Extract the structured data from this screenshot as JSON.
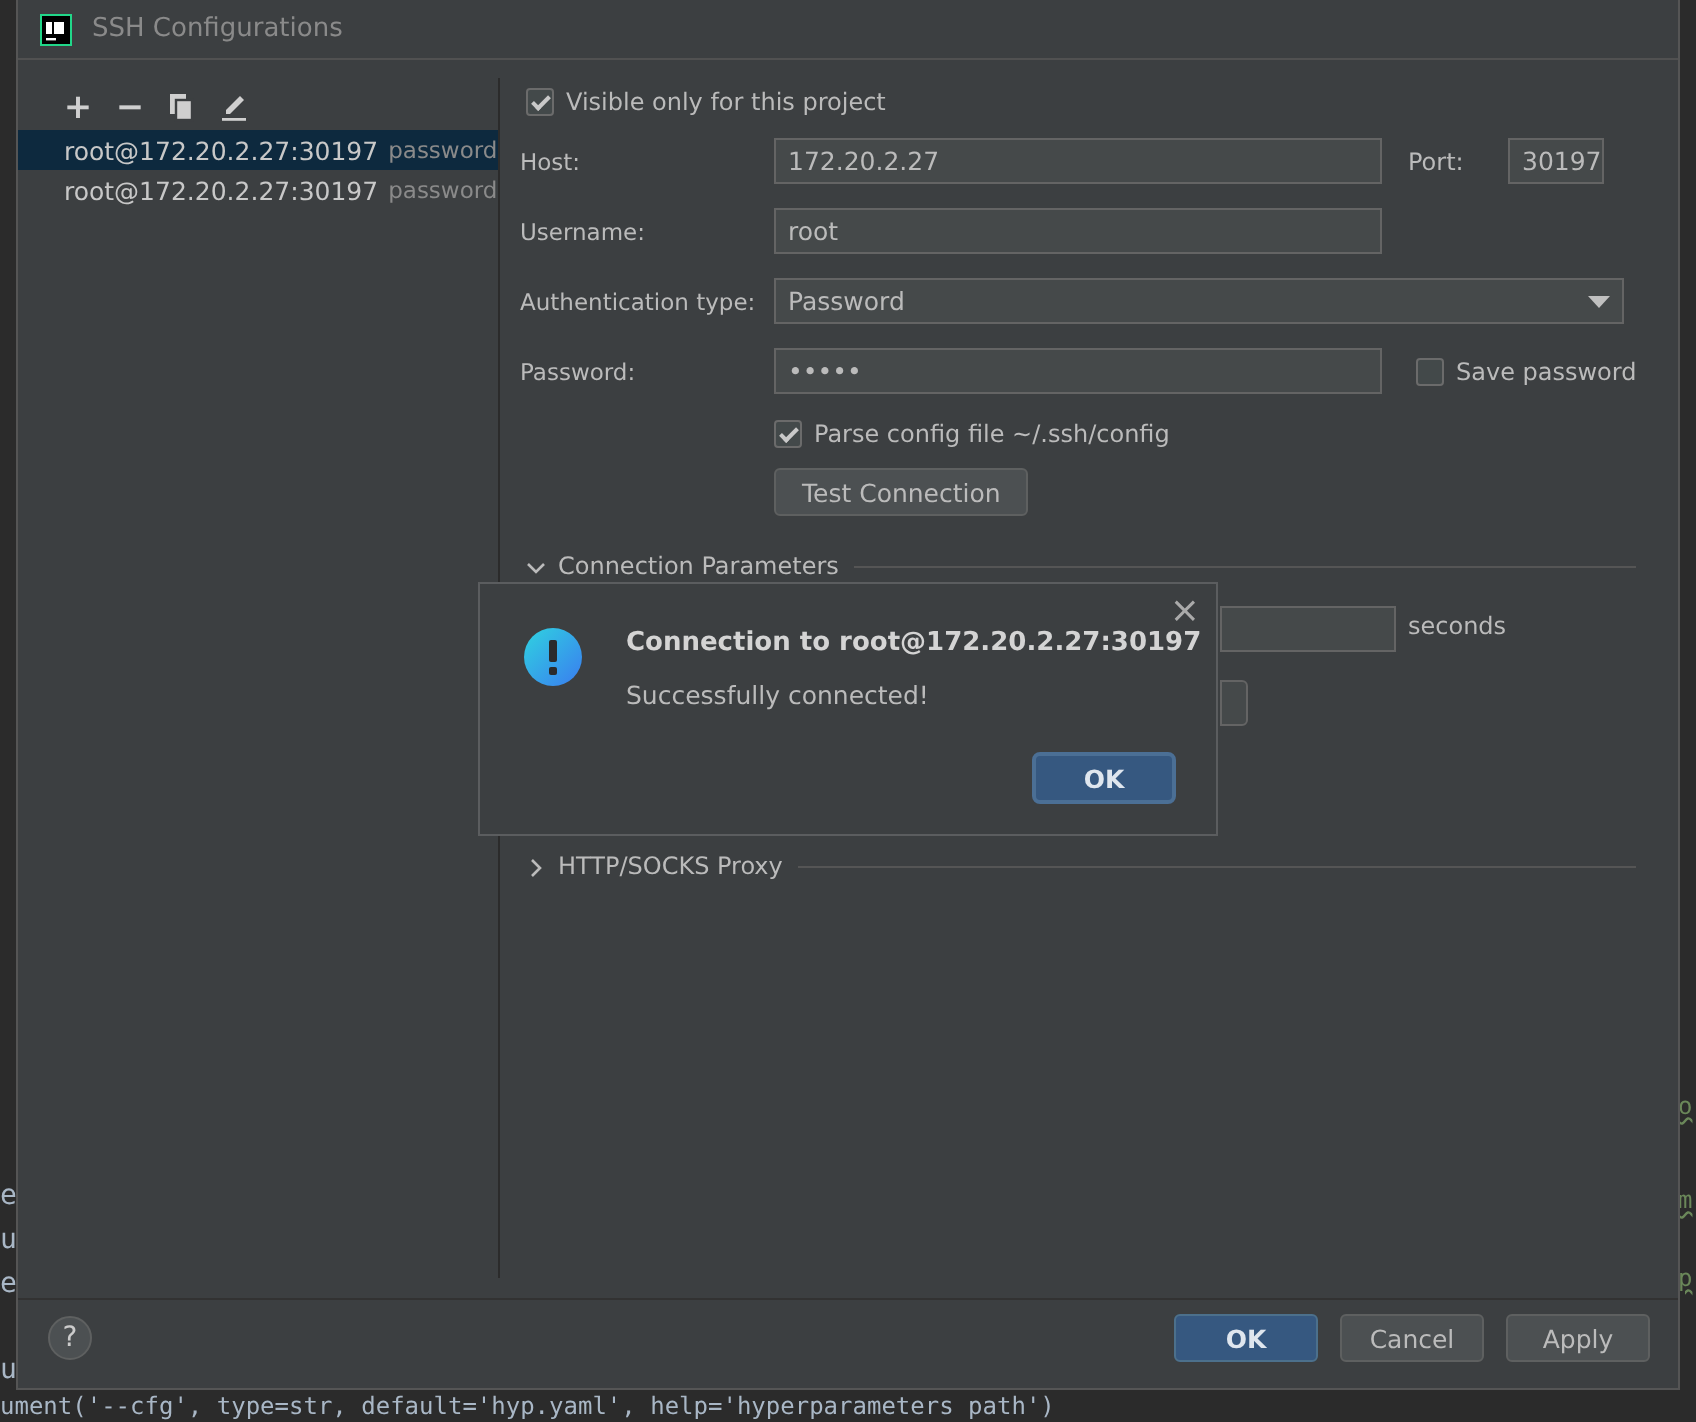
{
  "editor": {
    "left_fragments": [
      "e",
      "u",
      "e",
      "u"
    ],
    "right_fragments": [
      "o",
      "m",
      "p"
    ],
    "bottom_line": "ument('--cfg', type=str, default='hyp.yaml', help='hyperparameters path')"
  },
  "window": {
    "title": "SSH Configurations"
  },
  "toolbar": [
    "+",
    "−"
  ],
  "connections": [
    {
      "name": "root@172.20.2.27:30197",
      "auth": "password",
      "selected": true
    },
    {
      "name": "root@172.20.2.27:30197",
      "auth": "password",
      "selected": false
    }
  ],
  "form": {
    "visible_only_label": "Visible only for this project",
    "visible_only": true,
    "host_label": "Host:",
    "host": "172.20.2.27",
    "port_label": "Port:",
    "port": "30197",
    "username_label": "Username:",
    "username": "root",
    "auth_label": "Authentication type:",
    "auth_type": "Password",
    "password_label": "Password:",
    "password": "•••••",
    "save_password_label": "Save password",
    "save_password": false,
    "parse_config_label": "Parse config file ~/.ssh/config",
    "parse_config": true,
    "test_button": "Test Connection"
  },
  "sections": [
    {
      "title": "Connection Parameters",
      "expanded": true,
      "unit": "seconds"
    },
    {
      "title": "HTTP/SOCKS Proxy",
      "expanded": false
    }
  ],
  "buttons": [
    {
      "label": "OK",
      "kind": "primary"
    },
    {
      "label": "Cancel",
      "kind": "normal"
    },
    {
      "label": "Apply",
      "kind": "normal"
    }
  ],
  "help": "?",
  "message": {
    "title": "Connection to root@172.20.2.27:30197",
    "text": "Successfully connected!",
    "button": "OK",
    "close": "×"
  }
}
